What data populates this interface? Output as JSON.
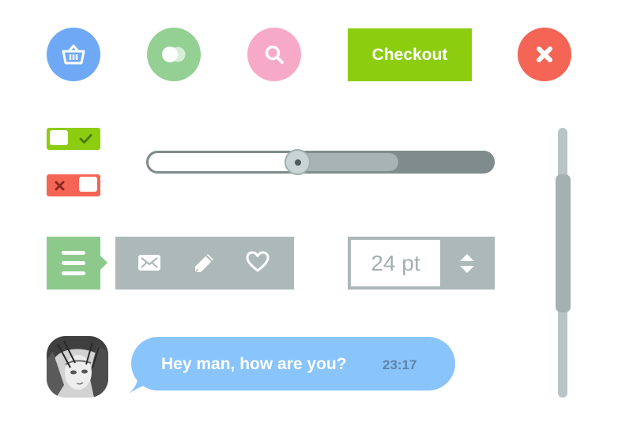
{
  "colors": {
    "basket_blue": "#6fa8f4",
    "toggle_green": "#94d093",
    "search_pink": "#f7a9c8",
    "checkout_green": "#8ccd10",
    "close_red": "#f46556",
    "slate_gray": "#acb9b8",
    "menu_green": "#8ec98c",
    "bubble_blue": "#89c4fb"
  },
  "icons": {
    "basket": "basket-icon",
    "toggle": "toggle-icon",
    "search": "search-icon",
    "close": "close-icon",
    "menu": "menu-icon",
    "mail": "mail-icon",
    "edit": "pencil-icon",
    "favorite": "heart-icon",
    "stepper": "up-down-arrows-icon"
  },
  "toolbar": {
    "checkout_label": "Checkout"
  },
  "switches": {
    "on_state": true,
    "off_state": false
  },
  "slider": {
    "value_fraction": 0.43,
    "buffered_fraction": 0.73
  },
  "vertical_scroll": {
    "thumb_start_fraction": 0.17,
    "thumb_end_fraction": 0.68
  },
  "font_size": {
    "value": "24 pt"
  },
  "chat": {
    "message": "Hey man, how are you?",
    "time": "23:17"
  }
}
